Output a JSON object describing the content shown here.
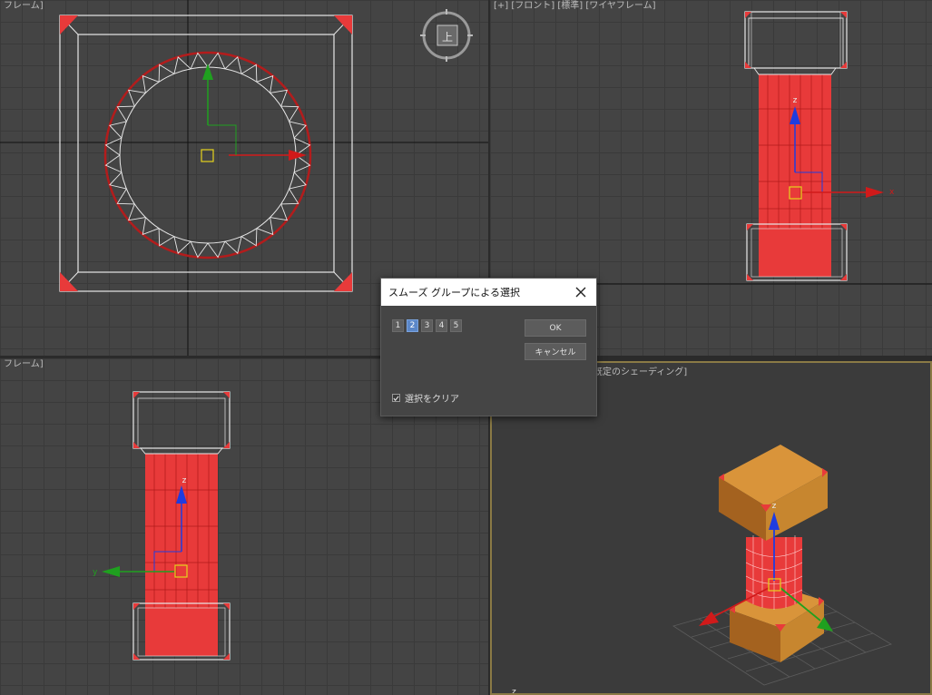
{
  "viewports": {
    "top": {
      "label": "フレーム]"
    },
    "front": {
      "label": "[+] [フロント] [標準] [ワイヤフレーム]"
    },
    "left": {
      "label": "フレーム]"
    },
    "perspective": {
      "label": "既定のシェーディング]"
    }
  },
  "viewcube": {
    "face_label": "上"
  },
  "axis_labels": {
    "z": "z",
    "x": "x",
    "y": "y"
  },
  "dialog": {
    "title": "スムーズ グループによる選択",
    "group_buttons": [
      "1",
      "2",
      "3",
      "4",
      "5"
    ],
    "active_group": "2",
    "ok_label": "OK",
    "cancel_label": "キャンセル",
    "clear_selection_label": "選択をクリア",
    "clear_selection_checked": true
  },
  "colors": {
    "selection_red": "#e83a3a",
    "wood": "#c7862f",
    "wire": "#ffffff",
    "axis_z": "#1f3ce0",
    "axis_x": "#d11a1a",
    "axis_y": "#1fa01f"
  },
  "icons": {
    "close": "close-icon",
    "checkbox": "checkmark-icon"
  }
}
